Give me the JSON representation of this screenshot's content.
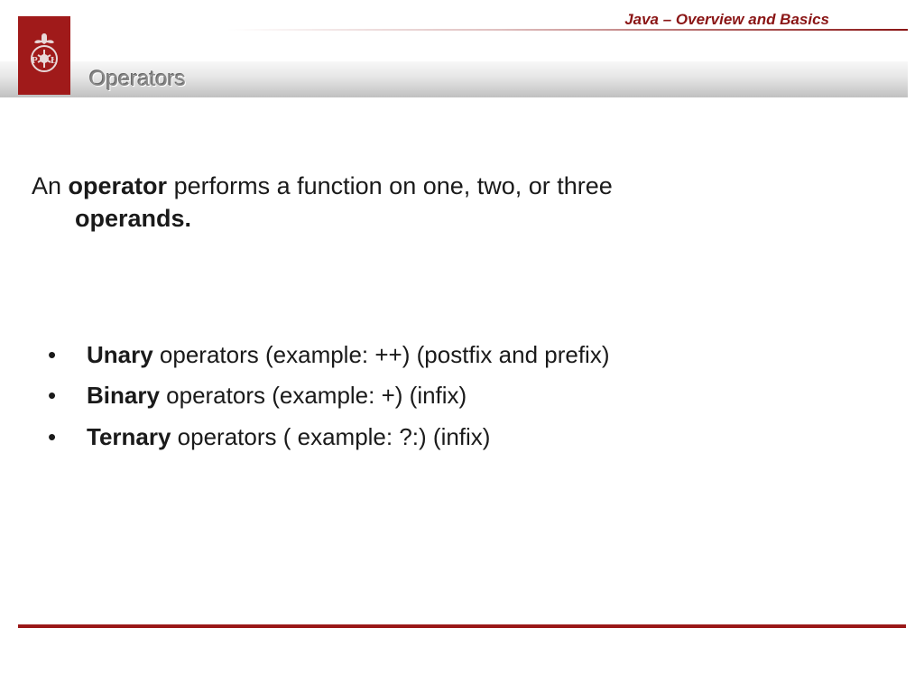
{
  "header": {
    "course_title": "Java – Overview and Basics",
    "slide_title": "Operators"
  },
  "content": {
    "intro": {
      "pre": "An ",
      "bold1": "operator",
      "mid": " performs a function on one, two, or three ",
      "bold2": "operands."
    },
    "bullets": [
      {
        "bold": "Unary",
        "rest": " operators (example: ++) (postfix and prefix)"
      },
      {
        "bold": "Binary",
        "rest": " operators (example: +) (infix)"
      },
      {
        "bold": "Ternary",
        "rest": " operators ( example: ?:) (infix)"
      }
    ]
  },
  "colors": {
    "accent": "#9a1818"
  }
}
